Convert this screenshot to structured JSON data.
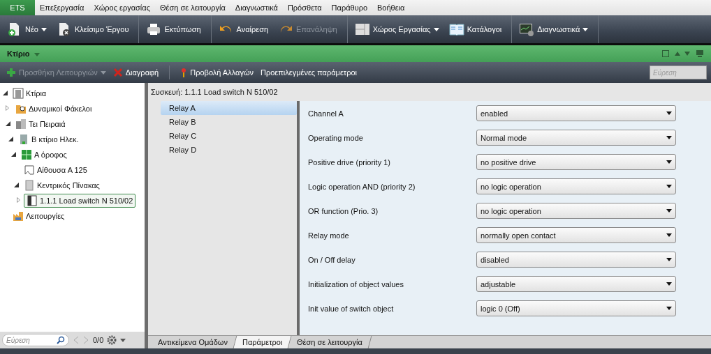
{
  "menu": {
    "app_button": "ETS",
    "items": [
      "Επεξεργασία",
      "Χώρος εργασίας",
      "Θέση σε λειτουργία",
      "Διαγνωστικά",
      "Πρόσθετα",
      "Παράθυρο",
      "Βοήθεια"
    ]
  },
  "toolbar": [
    {
      "label": "Νέο",
      "kind": "new",
      "dropdown": true,
      "disabled": false
    },
    {
      "label": "Κλείσιμο Έργου",
      "kind": "close",
      "dropdown": false,
      "disabled": false
    },
    {
      "label": "Εκτύπωση",
      "kind": "print",
      "dropdown": false,
      "disabled": false
    },
    {
      "label": "Αναίρεση",
      "kind": "undo",
      "dropdown": false,
      "disabled": false
    },
    {
      "label": "Επανάληψη",
      "kind": "redo",
      "dropdown": false,
      "disabled": true
    },
    {
      "label": "Χώρος Εργασίας",
      "kind": "workspace",
      "dropdown": true,
      "disabled": false
    },
    {
      "label": "Κατάλογοι",
      "kind": "catalog",
      "dropdown": false,
      "disabled": false
    },
    {
      "label": "Διαγνωστικά",
      "kind": "diagnostics",
      "dropdown": true,
      "disabled": false
    }
  ],
  "panel": {
    "title": "Κτίριο"
  },
  "actions": [
    {
      "label": "Προσθήκη Λειτουργιών",
      "kind": "add",
      "dropdown": true,
      "disabled": true
    },
    {
      "label": "Διαγραφή",
      "kind": "delete",
      "dropdown": false,
      "disabled": false
    },
    {
      "label": "Προβολή Αλλαγών",
      "kind": "pin",
      "dropdown": false,
      "disabled": false
    },
    {
      "label": "Προεπιλεγμένες παράμετροι",
      "kind": "text",
      "dropdown": false,
      "disabled": false
    }
  ],
  "search": {
    "placeholder": "Εύρεση"
  },
  "tree": [
    {
      "label": "Κτίρια",
      "kind": "buildings",
      "expanded": true,
      "selected": false,
      "children": [
        {
          "label": "Δυναμικοί Φάκελοι",
          "kind": "folder",
          "expanded": false,
          "selected": false
        },
        {
          "label": "Τει Πειραιά",
          "kind": "site",
          "expanded": true,
          "selected": false,
          "children": [
            {
              "label": "Β κτίριο Ηλεκ.",
              "kind": "building",
              "expanded": true,
              "selected": false,
              "children": [
                {
                  "label": "Α όροφος",
                  "kind": "floor",
                  "expanded": true,
                  "selected": false,
                  "children": [
                    {
                      "label": "Αίθουσα Α 125",
                      "kind": "room",
                      "selected": false
                    },
                    {
                      "label": "Κεντρικός Πίνακας",
                      "kind": "cabinet",
                      "expanded": true,
                      "selected": false,
                      "children": [
                        {
                          "label": "1.1.1  Load switch N 510/02",
                          "kind": "device",
                          "expanded": false,
                          "selected": true
                        }
                      ]
                    }
                  ]
                }
              ]
            }
          ]
        }
      ]
    },
    {
      "label": "Λειτουργίες",
      "kind": "functions",
      "selected": false
    }
  ],
  "tree_footer": {
    "search_placeholder": "Εύρεση",
    "count": "0/0"
  },
  "device": {
    "title": "Συσκευή: 1.1.1  Load switch N 510/02"
  },
  "channels": [
    {
      "label": "Relay A",
      "selected": true
    },
    {
      "label": "Relay B",
      "selected": false
    },
    {
      "label": "Relay C",
      "selected": false
    },
    {
      "label": "Relay D",
      "selected": false
    }
  ],
  "parameters": [
    {
      "name": "Channel A",
      "value": "enabled"
    },
    {
      "name": "Operating mode",
      "value": "Normal mode"
    },
    {
      "name": "Positive drive (priority 1)",
      "value": "no positive drive"
    },
    {
      "name": "Logic operation AND (priority 2)",
      "value": "no logic operation"
    },
    {
      "name": "OR function (Prio. 3)",
      "value": "no logic operation"
    },
    {
      "name": "Relay mode",
      "value": "normally open contact"
    },
    {
      "name": "On / Off delay",
      "value": "disabled"
    },
    {
      "name": "Initialization of object values",
      "value": "adjustable"
    },
    {
      "name": "Init value of switch object",
      "value": "logic 0 (Off)"
    }
  ],
  "bottom_tabs": [
    {
      "label": "Αντικείμενα Ομάδων",
      "selected": false
    },
    {
      "label": "Παράμετροι",
      "selected": true
    },
    {
      "label": "Θέση σε λειτουργία",
      "selected": false
    }
  ]
}
